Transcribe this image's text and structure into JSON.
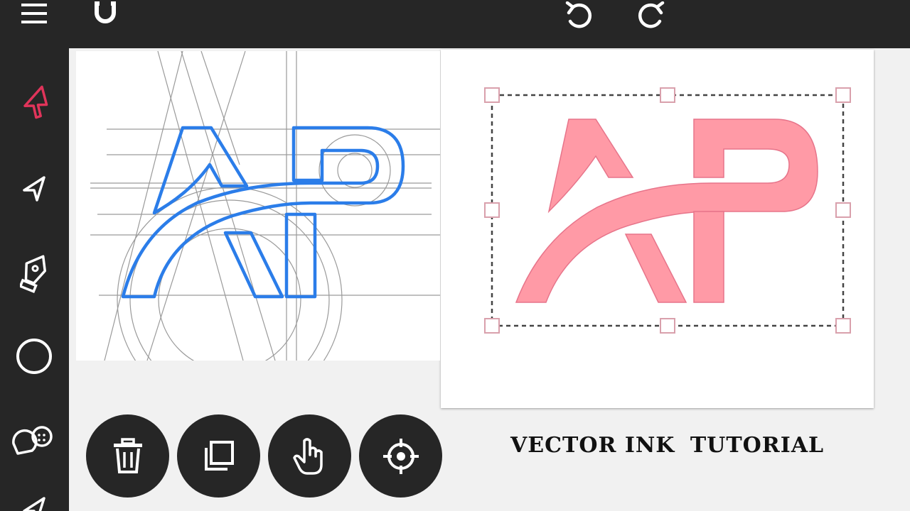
{
  "toolbar": {
    "menu_icon": "hamburger-menu-icon",
    "snap_icon": "magnet-icon",
    "undo_icon": "undo-icon",
    "redo_icon": "redo-icon"
  },
  "sidebar": {
    "tools": [
      {
        "name": "selection-tool",
        "icon": "arrow-cursor-icon",
        "active": true
      },
      {
        "name": "direct-selection-tool",
        "icon": "hollow-arrow-icon",
        "active": false
      },
      {
        "name": "pen-tool",
        "icon": "pen-nib-icon",
        "active": false
      },
      {
        "name": "shape-tool",
        "icon": "circle-icon",
        "active": false
      },
      {
        "name": "shape-builder-tool",
        "icon": "shape-builder-icon",
        "active": false
      }
    ]
  },
  "actions": [
    {
      "name": "delete-button",
      "icon": "trash-icon"
    },
    {
      "name": "duplicate-button",
      "icon": "copy-icon"
    },
    {
      "name": "pan-button",
      "icon": "hand-pointer-icon"
    },
    {
      "name": "center-button",
      "icon": "crosshair-icon"
    }
  ],
  "caption": {
    "part1": "VECTOR INK",
    "part2": "TUTORIAL"
  },
  "colors": {
    "chrome": "#262626",
    "active_tool": "#e0345a",
    "sketch_outline": "#2b7de9",
    "logo_fill": "#ff9aa6",
    "handle": "#d9a0ac"
  }
}
